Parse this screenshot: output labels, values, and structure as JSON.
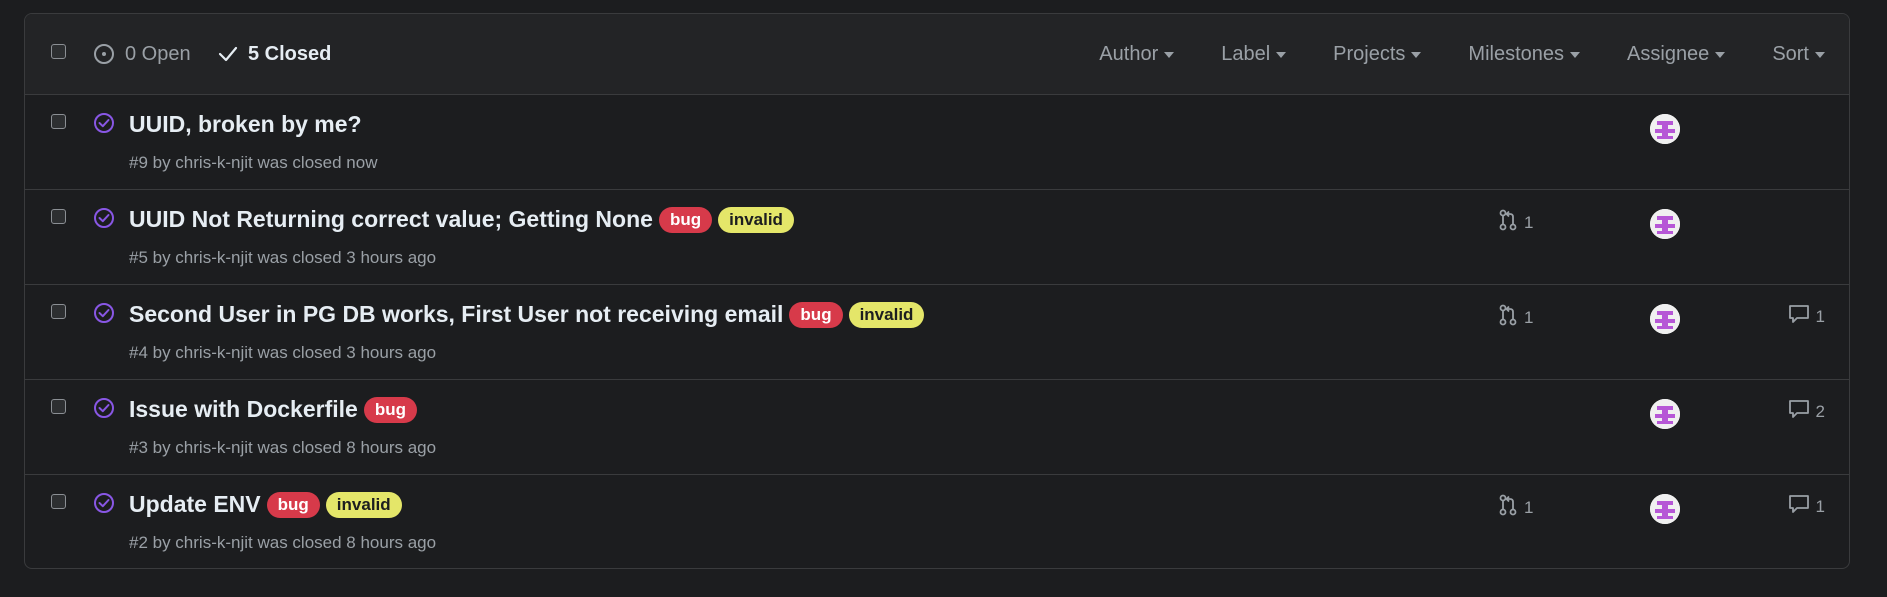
{
  "header": {
    "open_label": "0 Open",
    "closed_label": "5 Closed",
    "filters": [
      "Author",
      "Label",
      "Projects",
      "Milestones",
      "Assignee",
      "Sort"
    ]
  },
  "colors": {
    "closed_icon": "#8957e5",
    "label_bug": "#d73a4a",
    "label_invalid": "#e4e669",
    "avatar_purple": "#b657d6"
  },
  "issues": [
    {
      "title": "UUID, broken by me?",
      "labels": [],
      "meta": "#9 by chris-k-njit was closed now",
      "linked_prs": "",
      "comments": ""
    },
    {
      "title": "UUID Not Returning correct value; Getting None",
      "labels": [
        "bug",
        "invalid"
      ],
      "meta": "#5 by chris-k-njit was closed 3 hours ago",
      "linked_prs": "1",
      "comments": ""
    },
    {
      "title": "Second User in PG DB works, First User not receiving email",
      "labels": [
        "bug",
        "invalid"
      ],
      "meta": "#4 by chris-k-njit was closed 3 hours ago",
      "linked_prs": "1",
      "comments": "1"
    },
    {
      "title": "Issue with Dockerfile",
      "labels": [
        "bug"
      ],
      "meta": "#3 by chris-k-njit was closed 8 hours ago",
      "linked_prs": "",
      "comments": "2"
    },
    {
      "title": "Update ENV",
      "labels": [
        "bug",
        "invalid"
      ],
      "meta": "#2 by chris-k-njit was closed 8 hours ago",
      "linked_prs": "1",
      "comments": "1"
    }
  ]
}
